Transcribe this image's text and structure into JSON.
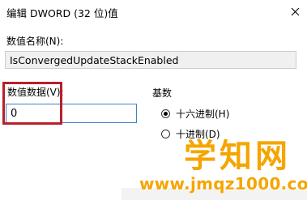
{
  "window": {
    "title": "编辑 DWORD (32 位)值"
  },
  "value_name": {
    "label": "数值名称(N):",
    "value": "IsConvergedUpdateStackEnabled"
  },
  "value_data": {
    "label": "数值数据(V):",
    "value": "0"
  },
  "base": {
    "label": "基数",
    "options": [
      {
        "label": "十六进制(H)",
        "selected": true
      },
      {
        "label": "十进制(D)",
        "selected": false
      }
    ]
  },
  "watermark": {
    "logo_text": "学知网",
    "url": "www.jmqz1000.com"
  },
  "colors": {
    "highlight": "#b8202a",
    "watermark": "#f5a500",
    "field_border": "#3c7fd0"
  },
  "icons": {
    "close": "close-icon"
  }
}
